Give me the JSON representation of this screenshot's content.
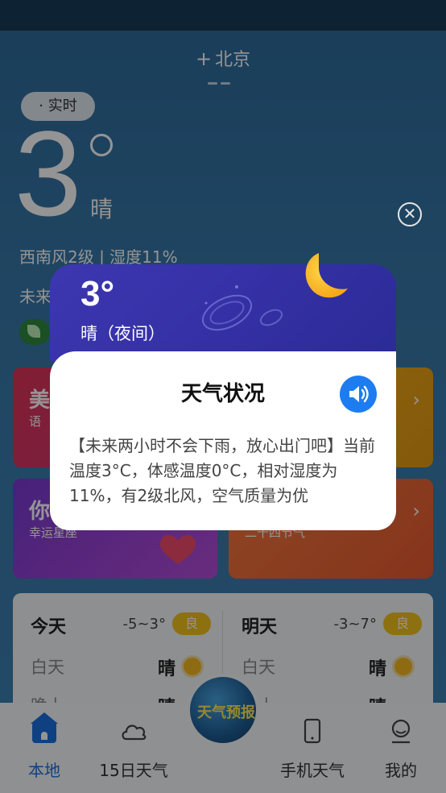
{
  "background": {
    "city": "北京",
    "realtime_label": "· 实时",
    "temperature": "3",
    "condition": "晴",
    "wind_humidity": "西南风2级 | 湿度11%",
    "future_partial": "未来",
    "cards": [
      {
        "title": "美",
        "subtitle": "语"
      },
      {
        "title": "",
        "subtitle": ""
      },
      {
        "title": "你",
        "subtitle": "幸运星座"
      },
      {
        "title": "",
        "subtitle": "二十四节气"
      }
    ],
    "forecast": {
      "today": {
        "day": "今天",
        "range": "-5~3°",
        "aqi": "良",
        "day_label": "白天",
        "day_value": "晴",
        "night_label": "晚上",
        "night_value": "晴"
      },
      "tomorrow": {
        "day": "明天",
        "range": "-3~7°",
        "aqi": "良",
        "day_label": "白天",
        "day_value": "晴",
        "night_label": "晚上",
        "night_value": "晴"
      }
    },
    "nav": [
      {
        "label": "本地",
        "icon": "home-icon",
        "active": true
      },
      {
        "label": "15日天气",
        "icon": "cloud-icon",
        "active": false
      },
      {
        "label": "手机天气",
        "icon": "phone-icon",
        "active": false
      },
      {
        "label": "我的",
        "icon": "profile-icon",
        "active": false
      }
    ],
    "center_button": "天气预报"
  },
  "modal": {
    "temperature": "3°",
    "condition": "晴（夜间）",
    "title": "天气状况",
    "description": "【未来两小时不会下雨，放心出门吧】当前温度3°C，体感温度0°C，相对湿度为11%，有2级北风，空气质量为优",
    "colors": {
      "header": "#3430a4",
      "accent": "#1d7df0",
      "moon": "#f5b820"
    }
  },
  "close_icon": "close-icon"
}
